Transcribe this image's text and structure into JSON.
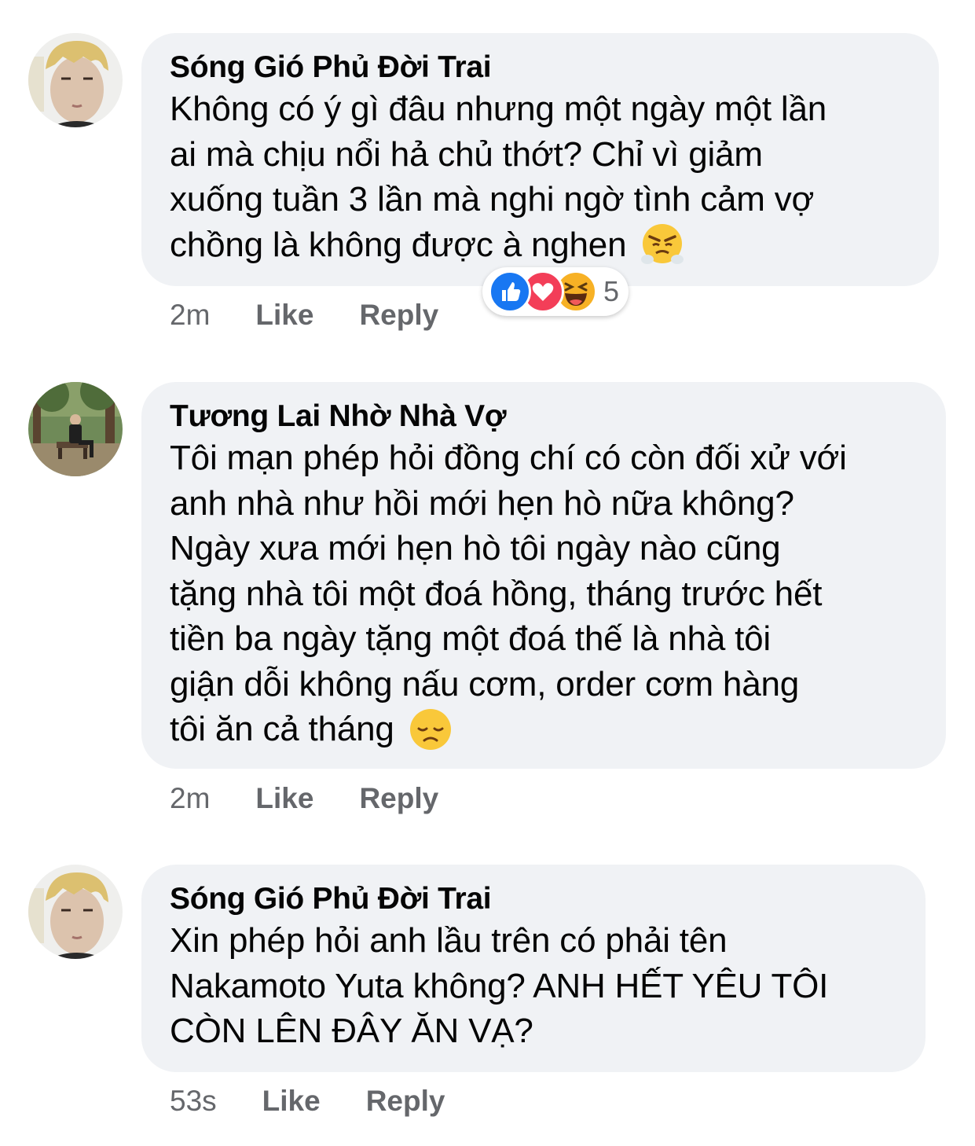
{
  "comments": [
    {
      "author": "Sóng Gió Phủ Đời Trai",
      "lines": [
        "Không có ý gì đâu nhưng một ngày một lần",
        "ai mà chịu nổi hả chủ thớt? Chỉ vì giảm",
        "xuống tuần 3 lần mà nghi ngờ tình cảm vợ",
        "chồng là không được à nghen"
      ],
      "end_emoji": "huffing-face-emoji",
      "time": "2m",
      "like_label": "Like",
      "reply_label": "Reply",
      "reactions": {
        "icons": [
          "like-reaction-icon",
          "love-reaction-icon",
          "haha-reaction-icon"
        ],
        "count": "5"
      }
    },
    {
      "author": "Tương Lai Nhờ Nhà Vợ",
      "lines": [
        "Tôi mạn phép hỏi đồng chí có còn đối xử với",
        "anh nhà như hồi mới hẹn hò nữa không?",
        "Ngày xưa mới hẹn hò tôi ngày nào cũng",
        "tặng nhà tôi một đoá hồng, tháng trước hết",
        "tiền ba ngày tặng một đoá thế là nhà tôi",
        "giận dỗi không nấu cơm, order cơm hàng",
        "tôi ăn cả tháng"
      ],
      "end_emoji": "disappointed-face-emoji",
      "time": "2m",
      "like_label": "Like",
      "reply_label": "Reply"
    },
    {
      "author": "Sóng Gió Phủ Đời Trai",
      "lines": [
        "Xin phép hỏi anh lầu trên có phải tên",
        "Nakamoto Yuta không? ANH HẾT YÊU TÔI",
        "CÒN LÊN ĐÂY ĂN VẠ?"
      ],
      "time": "53s",
      "like_label": "Like",
      "reply_label": "Reply"
    }
  ],
  "colors": {
    "bubble_bg": "#f0f2f5",
    "meta_text": "#65676b",
    "like_blue": "#1877f2",
    "love_red": "#f33e58",
    "haha_yellow": "#f7b125"
  }
}
